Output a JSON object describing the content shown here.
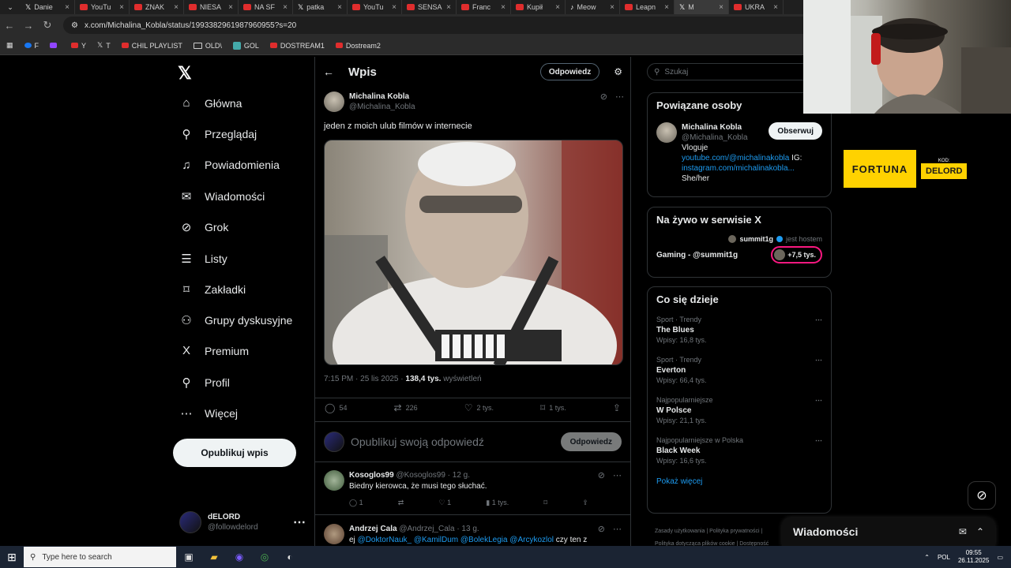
{
  "browser": {
    "tabs": [
      {
        "title": "Danie",
        "icon": "x"
      },
      {
        "title": "YouTu",
        "icon": "yt"
      },
      {
        "title": "ZNAK",
        "icon": "yt"
      },
      {
        "title": "NIESA",
        "icon": "yt"
      },
      {
        "title": "NA SF",
        "icon": "yt"
      },
      {
        "title": "patka",
        "icon": "x"
      },
      {
        "title": "YouTu",
        "icon": "yt"
      },
      {
        "title": "SENSA",
        "icon": "yt"
      },
      {
        "title": "Franc",
        "icon": "yt"
      },
      {
        "title": "Kupił",
        "icon": "yt"
      },
      {
        "title": "Meow",
        "icon": "tiktok"
      },
      {
        "title": "Leapn",
        "icon": "yt"
      },
      {
        "title": "M",
        "icon": "x"
      },
      {
        "title": "UKRA",
        "icon": "yt"
      }
    ],
    "url": "x.com/Michalina_Kobla/status/1993382961987960955?s=20",
    "bookmarks": [
      {
        "label": "F",
        "icon": "facebook"
      },
      {
        "label": "",
        "icon": "twitch"
      },
      {
        "label": "Y",
        "icon": "yt"
      },
      {
        "label": "T",
        "icon": "x"
      },
      {
        "label": "CHIL PLAYLIST",
        "icon": "yt"
      },
      {
        "label": "OLD\\",
        "icon": "folder"
      },
      {
        "label": "GOL",
        "icon": "g"
      },
      {
        "label": "DOSTREAM1",
        "icon": "yt"
      },
      {
        "label": "Dostream2",
        "icon": "yt"
      }
    ]
  },
  "nav": {
    "items": [
      {
        "label": "Główna",
        "icon": "home-icon",
        "glyph": "⌂"
      },
      {
        "label": "Przeglądaj",
        "icon": "search-icon",
        "glyph": "⚲"
      },
      {
        "label": "Powiadomienia",
        "icon": "bell-icon",
        "glyph": "♫"
      },
      {
        "label": "Wiadomości",
        "icon": "mail-icon",
        "glyph": "✉"
      },
      {
        "label": "Grok",
        "icon": "grok-icon",
        "glyph": "⊘"
      },
      {
        "label": "Listy",
        "icon": "list-icon",
        "glyph": "☰"
      },
      {
        "label": "Zakładki",
        "icon": "bookmark-icon",
        "glyph": "⌑"
      },
      {
        "label": "Grupy dyskusyjne",
        "icon": "communities-icon",
        "glyph": "⚇"
      },
      {
        "label": "Premium",
        "icon": "x-premium-icon",
        "glyph": "X"
      },
      {
        "label": "Profil",
        "icon": "profile-icon",
        "glyph": "⚲"
      },
      {
        "label": "Więcej",
        "icon": "more-icon",
        "glyph": "⋯"
      }
    ],
    "post_button": "Opublikuj wpis",
    "account": {
      "name": "dELORD",
      "handle": "@followdelord"
    }
  },
  "post": {
    "header_title": "Wpis",
    "header_reply": "Odpowiedz",
    "author_name": "Michalina Kobla",
    "author_handle": "@Michalina_Kobla",
    "text": "jeden z moich ulub filmów w internecie",
    "time": "7:15 PM · 25 lis 2025 · ",
    "views_count": "138,4 tys.",
    "views_label": " wyświetleń",
    "replies": "54",
    "reposts": "226",
    "likes": "2 tys.",
    "bookmarks": "1 tys.",
    "reply_placeholder": "Opublikuj swoją odpowiedź",
    "reply_button": "Odpowiedz"
  },
  "comments": [
    {
      "name": "Kosoglos99",
      "handle": "@Kosoglos99 · 12 g.",
      "text": "Biedny kierowca, że musi tego słuchać.",
      "replies": "1",
      "reposts": "",
      "likes": "1",
      "views": "1 tys."
    },
    {
      "name": "Andrzej Cala",
      "handle": "@Andrzej_Cala · 13 g.",
      "text_prefix": "ej ",
      "mentions": "@DoktorNauk_ @KamilDum @BolekLegia @Arcykozlol",
      "text_suffix": " czy ten z"
    }
  ],
  "sidebar": {
    "search_placeholder": "Szukaj",
    "related_title": "Powiązane osoby",
    "related_person": {
      "name": "Michalina Kobla",
      "handle": "@Michalina_Kobla",
      "follow": "Obserwuj",
      "bio_line1": "Vloguje",
      "bio_link1": "youtube.com/@michalinakobla",
      "bio_ig": " IG:",
      "bio_link2": "instagram.com/michalinakobla...",
      "bio_line3": "She/her"
    },
    "live_title": "Na żywo w serwisie X",
    "live_host": "summit1g",
    "live_host_suffix": "jest hostem",
    "live_space": "Gaming - @summit1g",
    "live_listeners": "+7,5 tys.",
    "trends_title": "Co się dzieje",
    "trends": [
      {
        "context": "Sport · Trendy",
        "name": "The Blues",
        "posts": "Wpisy: 16,8 tys."
      },
      {
        "context": "Sport · Trendy",
        "name": "Everton",
        "posts": "Wpisy: 66,4 tys."
      },
      {
        "context": "Najpopularniejsze",
        "name": "W Polsce",
        "posts": "Wpisy: 21,1 tys."
      },
      {
        "context": "Najpopularniejsze w Polska",
        "name": "Black Week",
        "posts": "Wpisy: 16,6 tys."
      }
    ],
    "show_more": "Pokaż więcej",
    "footer_line1": "Zasady użytkowania  |  Polityka prywatności  |",
    "footer_line2": "Polityka dotycząca plików cookie  |  Dostępność"
  },
  "messages_dock": "Wiadomości",
  "sponsor": {
    "brand": "FORTUNA",
    "code_label": "KOD:",
    "code": "DELORD"
  },
  "taskbar": {
    "search": "Type here to search",
    "lang": "POL",
    "time": "09:55",
    "date": "26.11.2025"
  },
  "colors": {
    "accent": "#1d9bf0",
    "bg": "#000000",
    "muted": "#71767b",
    "live": "#f91880",
    "sponsor": "#ffd200"
  }
}
